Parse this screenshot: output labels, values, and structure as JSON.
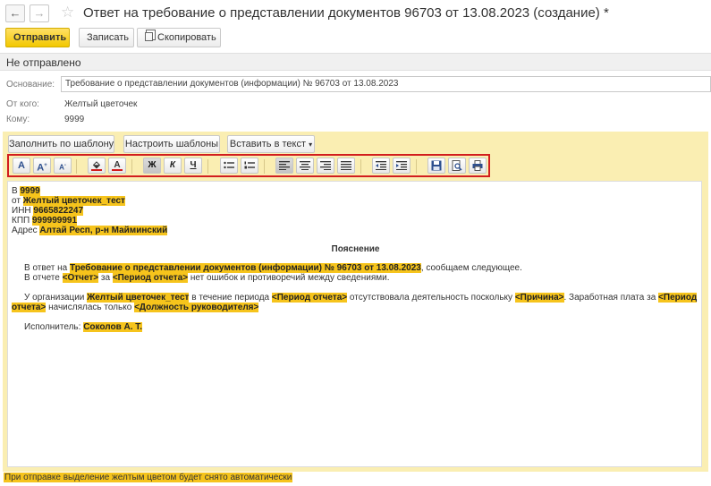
{
  "window": {
    "title": "Ответ на требование о представлении документов 96703 от 13.08.2023 (создание) *",
    "back_icon": "←",
    "forward_icon": "→",
    "star_icon": "☆"
  },
  "toolbar": {
    "send_label": "Отправить",
    "save_label": "Записать",
    "copy_label": "Скопировать"
  },
  "status": "Не отправлено",
  "fields": {
    "basis_label": "Основание:",
    "basis_value": "Требование о представлении документов (информации) № 96703 от 13.08.2023",
    "from_label": "От кого:",
    "from_value": "Желтый цветочек",
    "to_label": "Кому:",
    "to_value": "9999"
  },
  "editor_toolbar": {
    "fill_template": "Заполнить по шаблону",
    "setup_templates": "Настроить шаблоны",
    "insert_text": "Вставить в текст",
    "insert_arrow": "▾"
  },
  "format_buttons": {
    "font_a": "A",
    "font_grow": "A",
    "font_shrink": "A",
    "bg_color": "⬙",
    "text_color": "A",
    "bold": "Ж",
    "italic": "К",
    "underline": "Ч"
  },
  "document": {
    "line_to_prefix": "В",
    "line_to_value": "9999",
    "line_from_prefix": "от",
    "line_from_value": "Желтый цветочек_тест",
    "inn_prefix": "ИНН",
    "inn_value": "9665822247",
    "kpp_prefix": "КПП",
    "kpp_value": "999999991",
    "address_prefix": "Адрес",
    "address_value": "Алтай Респ, р-н Майминский",
    "heading": "Пояснение",
    "p1_a": "В ответ на",
    "p1_b": "Требование о представлении документов (информации) № 96703 от 13.08.2023",
    "p1_c": ", сообщаем следующее.",
    "p2_a": "В отчете",
    "p2_b": "<Отчет>",
    "p2_c": "за",
    "p2_d": "<Период отчета>",
    "p2_e": "нет ошибок и противоречий между сведениями.",
    "p3_a": "У организации",
    "p3_b": "Желтый цветочек_тест",
    "p3_c": "в течение периода",
    "p3_d": "<Период отчета>",
    "p3_e": "отсутствовала деятельность поскольку",
    "p3_f": "<Причина>",
    "p3_g": ". Заработная плата за",
    "p3_h": "<Период",
    "p3_i": "отчета>",
    "p3_j": "начислялась только",
    "p3_k": "<Должность руководителя>",
    "p4_a": "Исполнитель:",
    "p4_b": "Соколов А. Т."
  },
  "footnote": "При отправке выделение желтым цветом будет снято автоматически"
}
